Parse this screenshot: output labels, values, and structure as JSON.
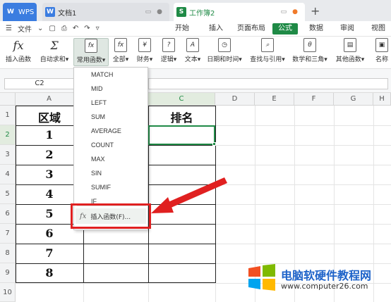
{
  "tabs": {
    "wps": "WPS",
    "doc": "文档1",
    "sheet": "工作簿2",
    "add": "+"
  },
  "menu": {
    "file": "文件",
    "tabs": [
      "开始",
      "插入",
      "页面布局",
      "公式",
      "数据",
      "审阅",
      "视图"
    ],
    "active": "公式"
  },
  "ribbon": [
    {
      "icon": "fx",
      "label": "插入函数"
    },
    {
      "icon": "Σ",
      "label": "自动求和▾"
    },
    {
      "icon": "fx",
      "label": "常用函数▾"
    },
    {
      "icon": "fx",
      "label": "全部▾"
    },
    {
      "icon": "¥",
      "label": "财务▾"
    },
    {
      "icon": "?",
      "label": "逻辑▾"
    },
    {
      "icon": "A",
      "label": "文本▾"
    },
    {
      "icon": "◷",
      "label": "日期和时间▾"
    },
    {
      "icon": "⌕",
      "label": "查找与引用▾"
    },
    {
      "icon": "θ",
      "label": "数学和三角▾"
    },
    {
      "icon": "▤",
      "label": "其他函数▾"
    },
    {
      "icon": "▣",
      "label": "名称"
    }
  ],
  "namebox": "C2",
  "columns": [
    "A",
    "B",
    "C",
    "D",
    "E",
    "F",
    "G",
    "H"
  ],
  "rows": [
    "1",
    "2",
    "3",
    "4",
    "5",
    "6",
    "7",
    "8",
    "9",
    "10"
  ],
  "cells": {
    "a1": "区域",
    "c1": "排名",
    "a_values": [
      "1",
      "2",
      "3",
      "4",
      "5",
      "6",
      "7",
      "8"
    ]
  },
  "dropdown": {
    "items": [
      "MATCH",
      "MID",
      "LEFT",
      "SUM",
      "AVERAGE",
      "COUNT",
      "MAX",
      "SIN",
      "SUMIF",
      "IF"
    ],
    "insert_label": "插入函数(F)...",
    "insert_icon": "fx"
  },
  "watermark": {
    "title": "电脑软硬件教程网",
    "url": "www.computer26.com"
  },
  "colors": {
    "accent": "#1f8a46",
    "highlight": "#e02020",
    "wps_blue": "#3b7de0"
  }
}
